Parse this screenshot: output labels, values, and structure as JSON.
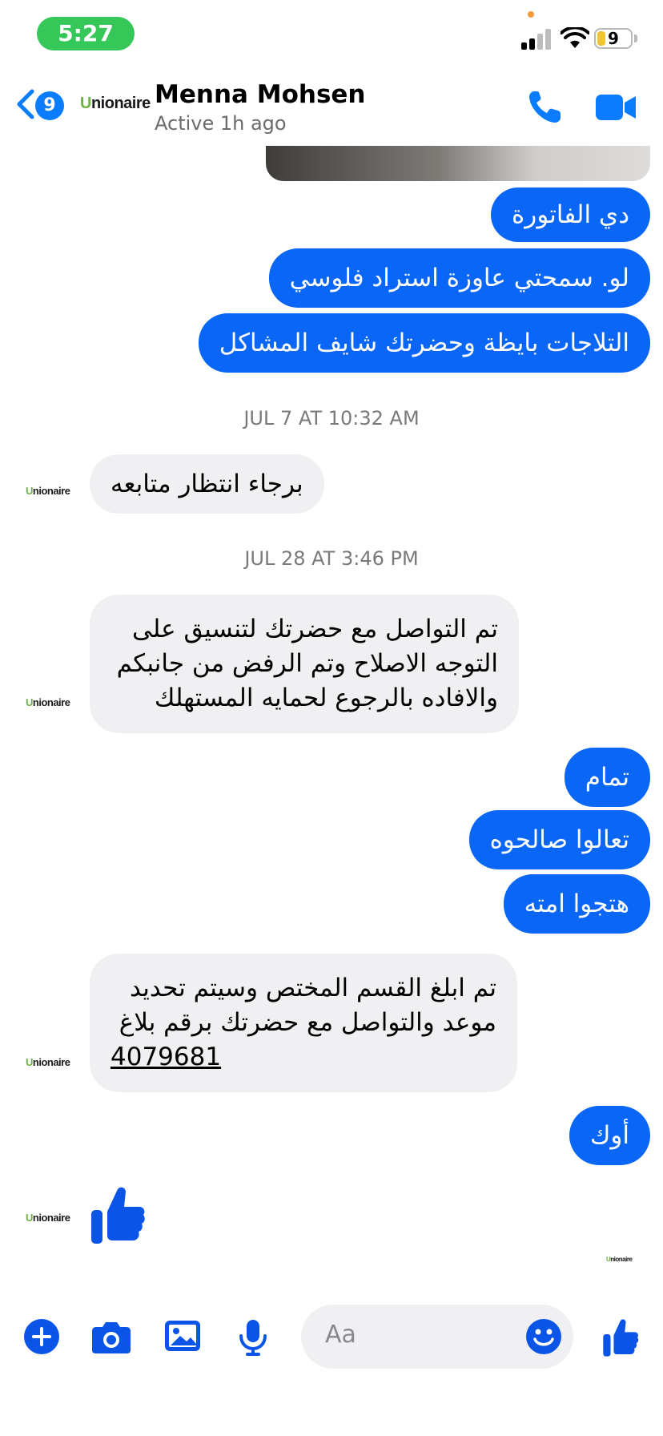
{
  "status_bar": {
    "time": "5:27",
    "battery": "9"
  },
  "header": {
    "back_count": "9",
    "logo_u": "U",
    "logo_rest": "nionaire",
    "name": "Menna Mohsen",
    "status": "Active 1h ago"
  },
  "messages": {
    "out1": "دي الفاتورة",
    "out2": "لو. سمحتي عاوزة استراد فلوسي",
    "out3": "التلاجات بايظة وحضرتك شايف المشاكل",
    "time1": "JUL 7 AT 10:32 AM",
    "in1": "برجاء انتظار متابعه",
    "time2": "JUL 28 AT 3:46 PM",
    "in2_l1": "تم التواصل مع حضرتك لتنسيق على",
    "in2_l2": "التوجه الاصلاح وتم الرفض من جانبكم",
    "in2_l3": "والافاده بالرجوع لحمايه المستهلك",
    "out4": "تمام",
    "out5": "تعالوا صالحوه",
    "out6": "هتجوا امته",
    "in3_l1": "تم ابلغ القسم المختص وسيتم تحديد",
    "in3_l2": "موعد والتواصل مع حضرتك برقم بلاغ",
    "in3_l3": "4079681",
    "out7": "أوك"
  },
  "composer": {
    "placeholder": "Aa"
  },
  "colors": {
    "accent": "#0a66f6",
    "brand_green": "#6db33f",
    "status_green": "#36c759"
  },
  "icons": [
    "back-chevron-icon",
    "phone-icon",
    "video-icon",
    "plus-icon",
    "camera-icon",
    "gallery-icon",
    "mic-icon",
    "emoji-icon",
    "thumbs-up-icon"
  ]
}
